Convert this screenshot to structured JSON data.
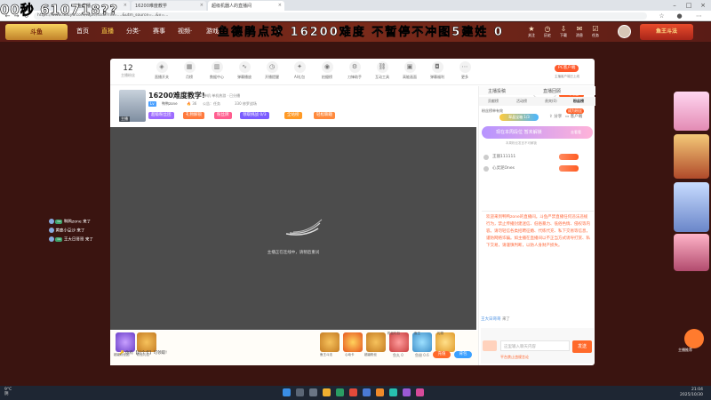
{
  "watermark": {
    "left": "00秒 610718??",
    "middle": "鱼德鹃点球 16200难度 不暂停不冲图5建姓 0"
  },
  "browser": {
    "tabs": [
      {
        "label": "斗鱼直播"
      },
      {
        "label": "16200难度教学"
      },
      {
        "label": "超级机器人的直播间"
      }
    ],
    "url": "https://www.douyu.com/topic/ssdx?rid=....&utm_source=...&v=..."
  },
  "header": {
    "logo": "斗鱼",
    "nav": [
      {
        "label": "首页"
      },
      {
        "label": "直播",
        "active": true
      },
      {
        "label": "分类·"
      },
      {
        "label": "赛事"
      },
      {
        "label": "视频·"
      },
      {
        "label": "游戏·"
      }
    ],
    "icons": [
      {
        "icon": "medal-icon",
        "label": "关注"
      },
      {
        "icon": "history-icon",
        "label": "历史"
      },
      {
        "icon": "download-icon",
        "label": "下载"
      },
      {
        "icon": "mail-icon",
        "label": "消息"
      },
      {
        "icon": "task-icon",
        "label": "任务"
      }
    ],
    "promo": "鱼王斗法",
    "colors": {
      "header_bg": "#5a1c16",
      "accent": "#ff5d23"
    }
  },
  "toolbar": {
    "viewers": "12",
    "viewers_label": "主播粉丝",
    "tools": [
      {
        "icon": "gift-icon",
        "label": "直播开关"
      },
      {
        "icon": "calendar-icon",
        "label": "月榜"
      },
      {
        "icon": "chart-icon",
        "label": "数据中心"
      },
      {
        "icon": "wave-icon",
        "label": "弹幕播放"
      },
      {
        "icon": "clock-icon",
        "label": "开播提醒"
      },
      {
        "icon": "ai-icon",
        "label": "AI礼包"
      },
      {
        "icon": "camera-icon",
        "label": "拍摄榜"
      },
      {
        "icon": "gear-icon",
        "label": "刀锋助手"
      },
      {
        "icon": "link-icon",
        "label": "互动工具"
      },
      {
        "icon": "image-icon",
        "label": "高能画面"
      },
      {
        "icon": "bag-icon",
        "label": "弹幕福利"
      },
      {
        "icon": "more-icon",
        "label": "更多"
      }
    ],
    "pc_client": "PC客户端",
    "login_hint": "主播客户端已上线"
  },
  "anchor": {
    "title": "16200难度教学!",
    "category": "单机 单机热游 · 已分播",
    "name": "鸭鸭zone",
    "hot": "36",
    "announce": "公告：任务",
    "region": "330 修罗战场",
    "tag": "主播",
    "chips": [
      {
        "label": "超级粉丝团",
        "color": "#9d6bff"
      },
      {
        "label": "礼物解锁",
        "color": "#ff7a3d"
      },
      {
        "label": "粉丝牌",
        "color": "#ff5d8f"
      },
      {
        "label": "领取挑战  0/3",
        "color": "#7b5cff"
      },
      {
        "label": "全站榜",
        "color": "#ff9a26"
      },
      {
        "label": "轻松聊趣",
        "color": "#ff8a3d"
      }
    ],
    "room_id": "17979",
    "follow": "关注",
    "share": "分享",
    "client": "客户端",
    "gift_strip": "翠晶宝箱 1/3"
  },
  "player": {
    "message": "主播正在连线中，请稍后重试"
  },
  "bottom_bar": {
    "items": [
      {
        "label": "超级粉丝团"
      },
      {
        "label": "粉丝礼包"
      },
      {
        "label": "鱼王斗法"
      },
      {
        "label": "心动卡"
      },
      {
        "label": "超级粉丝"
      },
      {
        "label": "粉丝礼包"
      },
      {
        "label": "鱼王"
      },
      {
        "label": "礼物"
      }
    ],
    "fishball_label": "你有【0]个卡】可领取!",
    "fishball": "鱼丸 0",
    "fishpole": "鱼翅 0.6",
    "recharge": "充值",
    "backpack": "背包"
  },
  "side": {
    "top_tabs": [
      {
        "label": "主播投稿"
      },
      {
        "label": "直播回顾"
      }
    ],
    "rank_tabs": [
      {
        "label": "贡献榜"
      },
      {
        "label": "活动榜"
      },
      {
        "label": "贵宾(0)"
      },
      {
        "label": "粉丝榜",
        "active": true
      }
    ],
    "fans_label": "粉丝榜单有效",
    "fans_btn": "成为粉丝",
    "banner": "现在本周段位 暂未解锁",
    "banner_btn": "去看看",
    "banner_sub": "本周粉丝发言不可解锁",
    "ranks": [
      {
        "name": "王丽111111"
      },
      {
        "name": "心灵泥Ones"
      }
    ],
    "welcome": "欢迎来到鸭鸭zone的直播间。斗鱼严禁直播任何违法违规行为，禁止传播封建迷信、低俗暴力、低俗色情、侵权等内容。请勿轻信各类招聘征婚、代练代充、私下交易等信息，谨防网络诈骗。如主播在直播间以不正当方式诱导打赏、私下交易，请谨慎判断，以防人身财产损失。",
    "last_chat_who": "王大日哥哥",
    "last_chat_text": "来了",
    "chat_placeholder": "这里输入聊天内容",
    "send": "发送",
    "chat_hint": "平台禁止违规言论"
  },
  "left_chat": [
    {
      "name": "鸭鸭zone",
      "text": "来了"
    },
    {
      "name": "黄鹿小豆沙",
      "text": "来了"
    },
    {
      "name": "王大日哥哥",
      "text": "来了"
    }
  ],
  "event_stack": {
    "rec_label": "主播推荐"
  },
  "taskbar": {
    "temp": "9°C",
    "weather": "阴",
    "time": "21:04",
    "date": "2025/10/30"
  }
}
